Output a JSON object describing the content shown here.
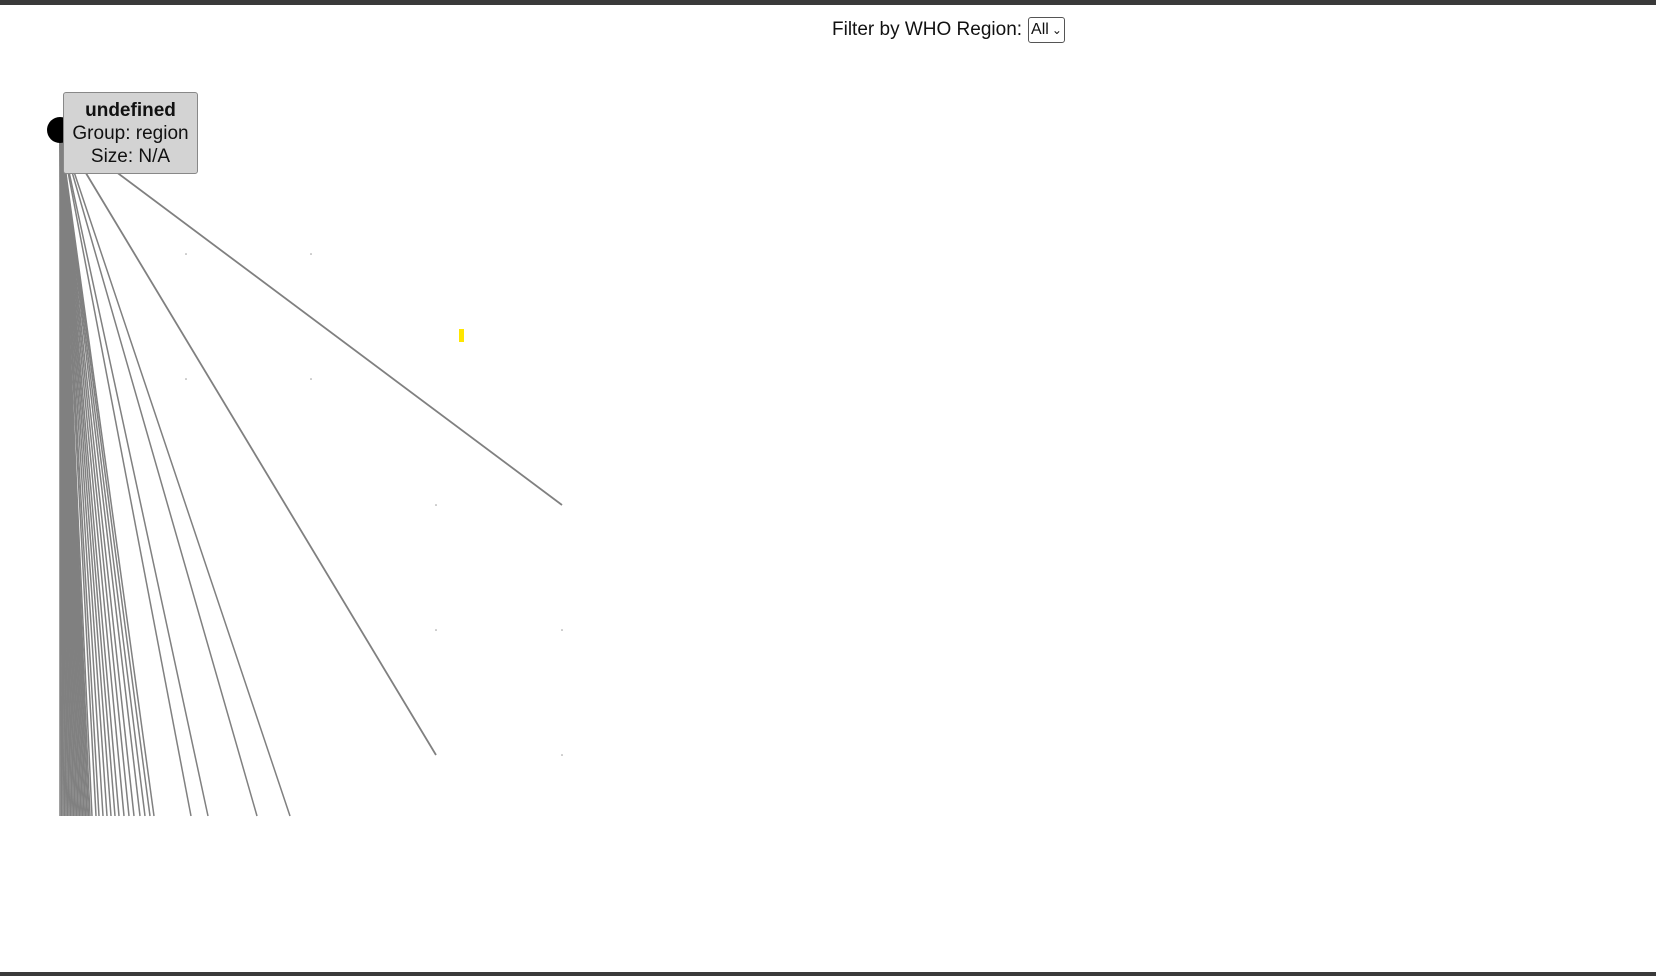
{
  "filter": {
    "label": "Filter by WHO Region:",
    "selected": "All"
  },
  "tooltip": {
    "title": "undefined",
    "group_line": "Group: region",
    "size_line": "Size: N/A"
  },
  "colors": {
    "node_fill": "#000000",
    "link_stroke": "#808080",
    "highlight": "#ffe600",
    "tooltip_bg": "#d3d3d3"
  },
  "icons": {
    "select_chevron": "chevron-down-icon"
  }
}
